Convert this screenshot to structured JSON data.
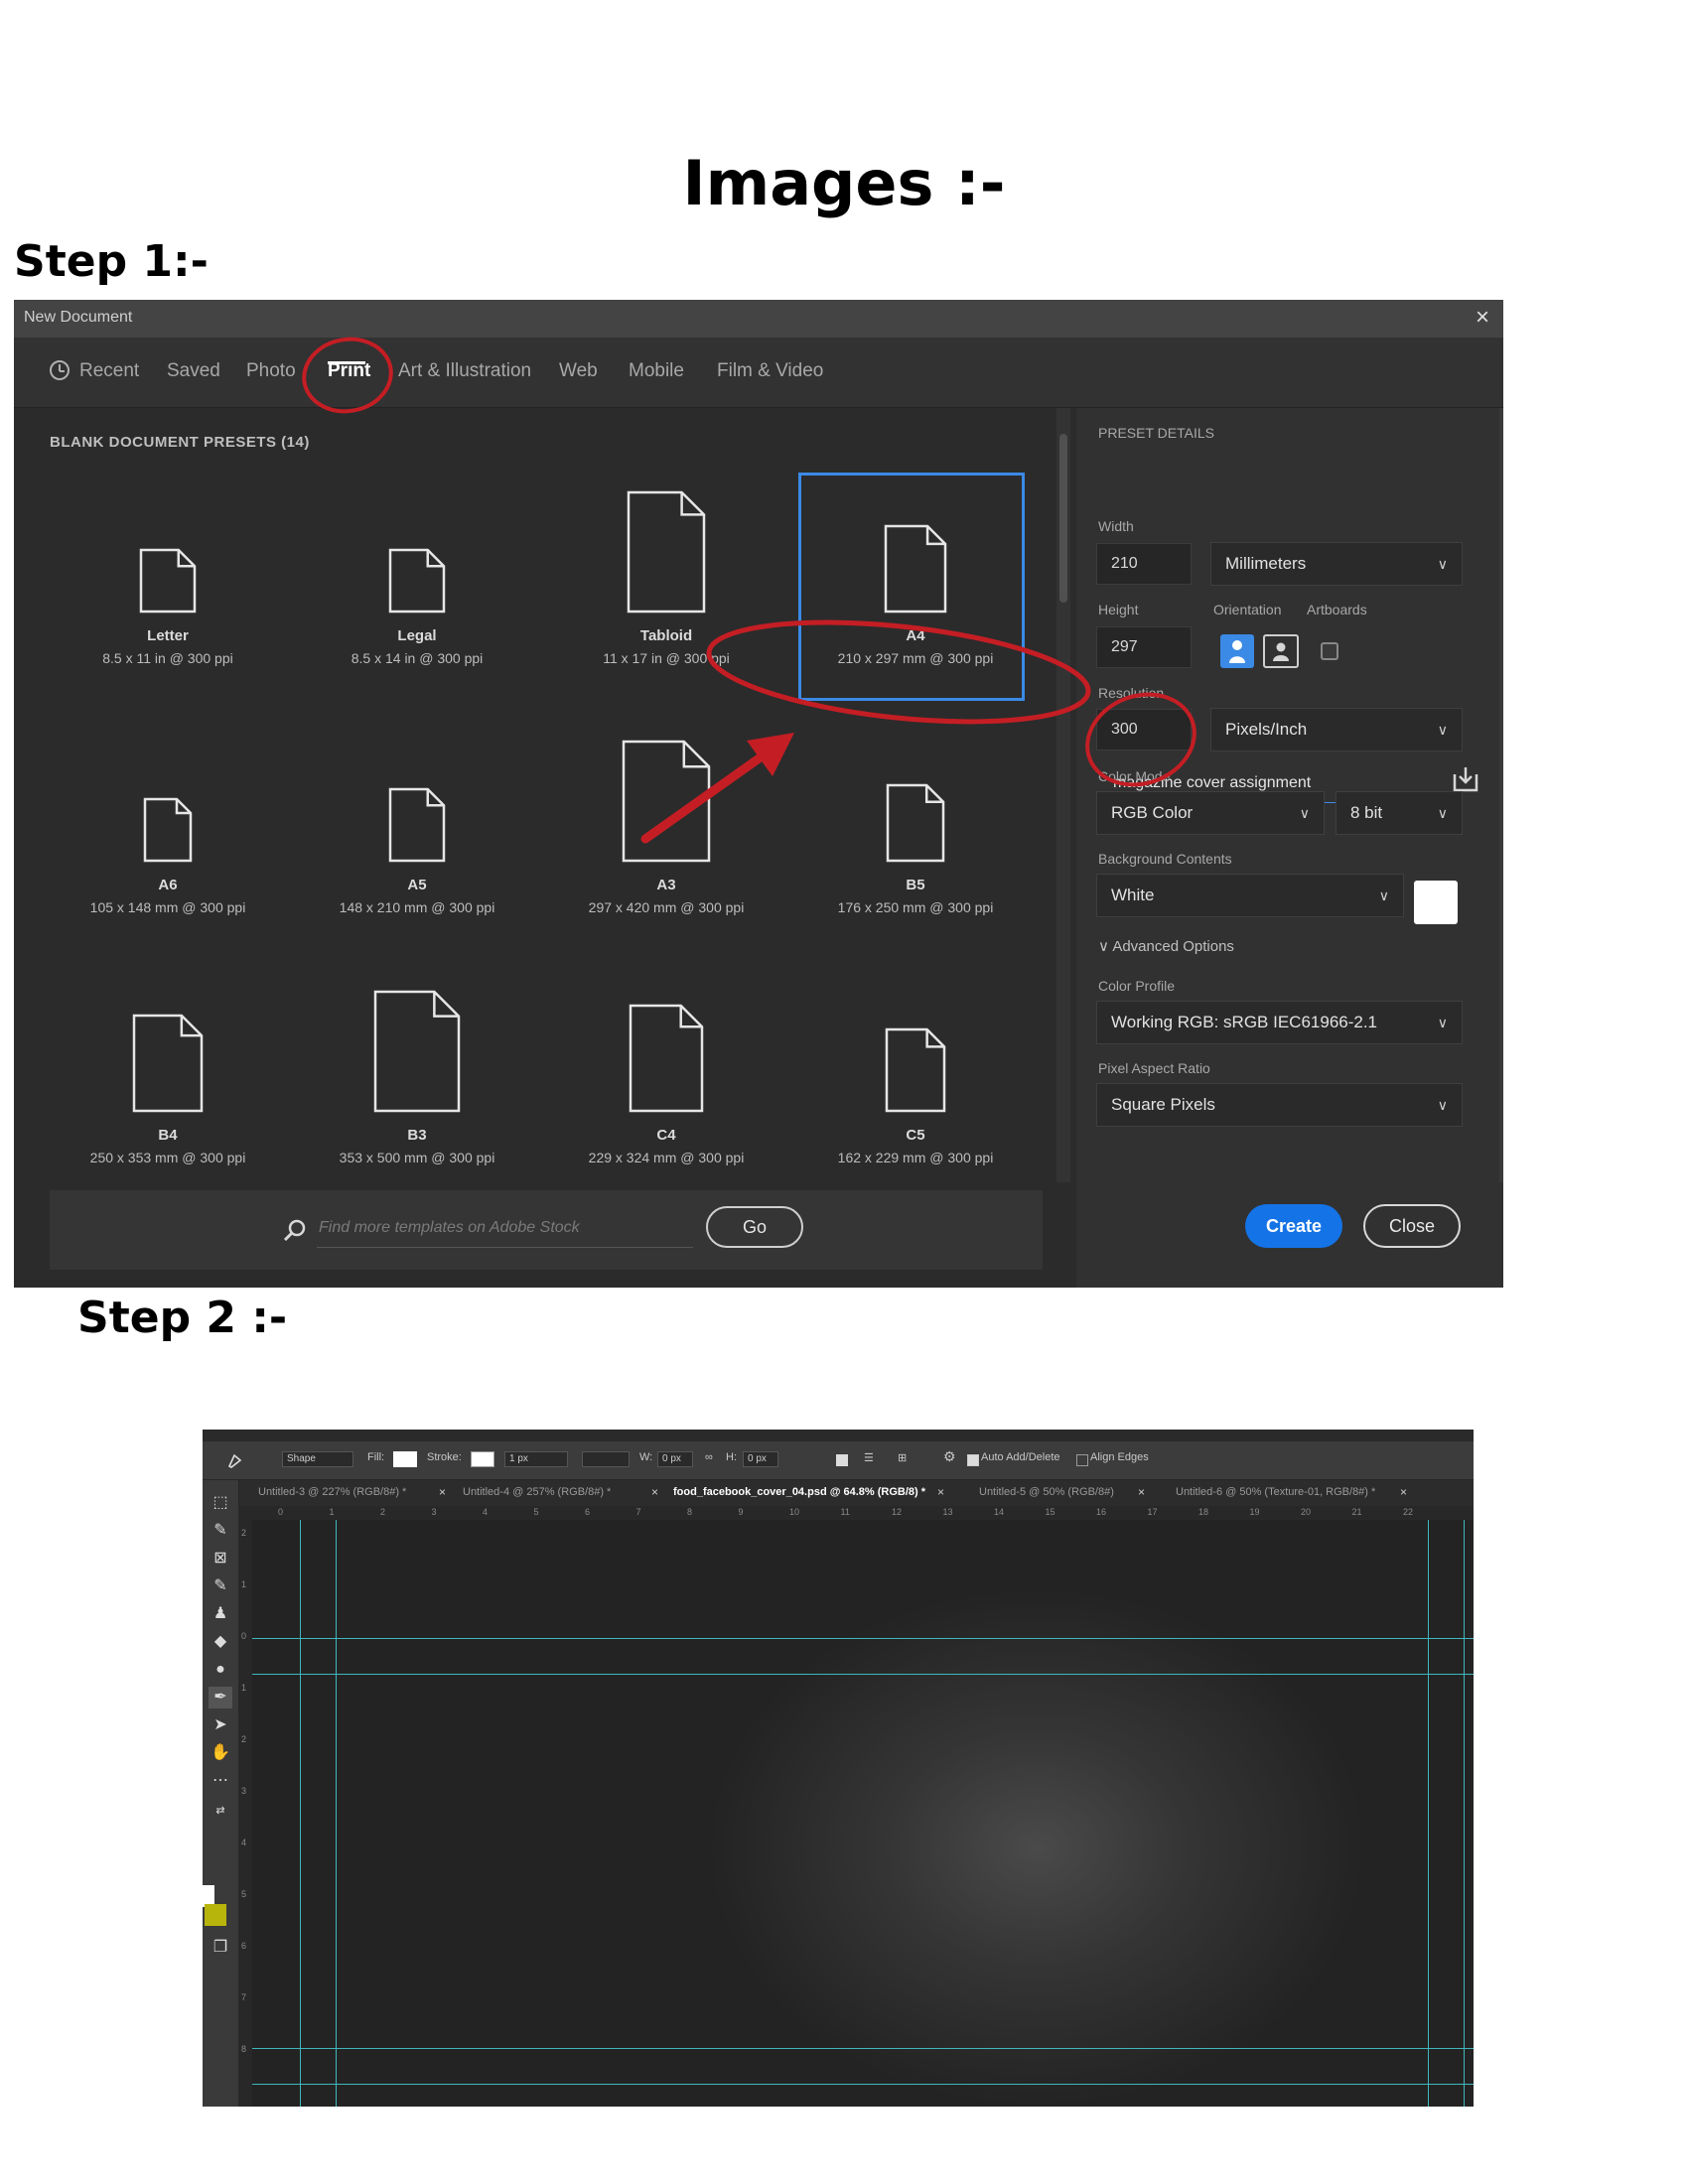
{
  "doc": {
    "title": "Images :-",
    "step1_label": "Step 1:-",
    "step2_label": "Step 2 :-"
  },
  "dialog": {
    "title": "New Document",
    "close_glyph": "×",
    "tabs": [
      "Recent",
      "Saved",
      "Photo",
      "Print",
      "Art & Illustration",
      "Web",
      "Mobile",
      "Film & Video"
    ],
    "active_tab": "Print",
    "presets_heading": "BLANK DOCUMENT PRESETS  (14)",
    "presets": [
      {
        "name": "Letter",
        "size": "8.5 x 11 in @ 300 ppi"
      },
      {
        "name": "Legal",
        "size": "8.5 x 14 in @ 300 ppi"
      },
      {
        "name": "Tabloid",
        "size": "11 x 17 in @ 300 ppi"
      },
      {
        "name": "A4",
        "size": "210 x 297 mm @ 300 ppi"
      },
      {
        "name": "A6",
        "size": "105 x 148 mm @ 300 ppi"
      },
      {
        "name": "A5",
        "size": "148 x 210 mm @ 300 ppi"
      },
      {
        "name": "A3",
        "size": "297 x 420 mm @ 300 ppi"
      },
      {
        "name": "B5",
        "size": "176 x 250 mm @ 300 ppi"
      },
      {
        "name": "B4",
        "size": "250 x 353 mm @ 300 ppi"
      },
      {
        "name": "B3",
        "size": "353 x 500 mm @ 300 ppi"
      },
      {
        "name": "C4",
        "size": "229 x 324 mm @ 300 ppi"
      },
      {
        "name": "C5",
        "size": "162 x 229 mm @ 300 ppi"
      }
    ],
    "selected_preset": "A4",
    "search_placeholder": "Find more templates on Adobe Stock",
    "go_label": "Go",
    "details": {
      "heading": "PRESET DETAILS",
      "name_value": "magazine cover assignment",
      "width_label": "Width",
      "width_value": "210",
      "width_unit": "Millimeters",
      "height_label": "Height",
      "height_value": "297",
      "orientation_label": "Orientation",
      "artboards_label": "Artboards",
      "resolution_label": "Resolution",
      "resolution_value": "300",
      "resolution_unit": "Pixels/Inch",
      "color_mode_label": "Color Mode",
      "color_mode": "RGB Color",
      "bit_depth": "8 bit",
      "bg_label": "Background Contents",
      "bg_value": "White",
      "advanced_label": "Advanced Options",
      "profile_label": "Color Profile",
      "profile_value": "Working RGB: sRGB IEC61966-2.1",
      "pixel_aspect_label": "Pixel Aspect Ratio",
      "pixel_aspect_value": "Square Pixels",
      "create_label": "Create",
      "close_label": "Close"
    }
  },
  "ps": {
    "options": {
      "mode": "Shape",
      "fill_label": "Fill:",
      "stroke_label": "Stroke:",
      "stroke_width": "1 px",
      "w_label": "W:",
      "w_value": "0 px",
      "h_label": "H:",
      "h_value": "0 px",
      "auto_add_delete": "Auto Add/Delete",
      "align_edges": "Align Edges"
    },
    "tabs": [
      {
        "label": "Untitled-3 @ 227% (RGB/8#) *"
      },
      {
        "label": "Untitled-4 @ 257% (RGB/8#) *"
      },
      {
        "label": "food_facebook_cover_04.psd @ 64.8% (RGB/8) *"
      },
      {
        "label": "Untitled-5 @ 50% (RGB/8#)"
      },
      {
        "label": "Untitled-6 @ 50% (Texture-01, RGB/8#) *"
      }
    ],
    "active_tab": 2,
    "ruler_top": [
      "0",
      "1",
      "2",
      "3",
      "4",
      "5",
      "6",
      "7",
      "8",
      "9",
      "10",
      "11",
      "12",
      "13",
      "14",
      "15",
      "16",
      "17",
      "18",
      "19",
      "20",
      "21",
      "22"
    ],
    "ruler_left": [
      "2",
      "1",
      "0",
      "1",
      "2",
      "3",
      "4",
      "5",
      "6",
      "7",
      "8"
    ],
    "colors": {
      "guide": "#3fb7bd",
      "foreground": "#b7b50c",
      "accent_blue": "#1473e6",
      "annotation_red": "#c41e24"
    }
  }
}
